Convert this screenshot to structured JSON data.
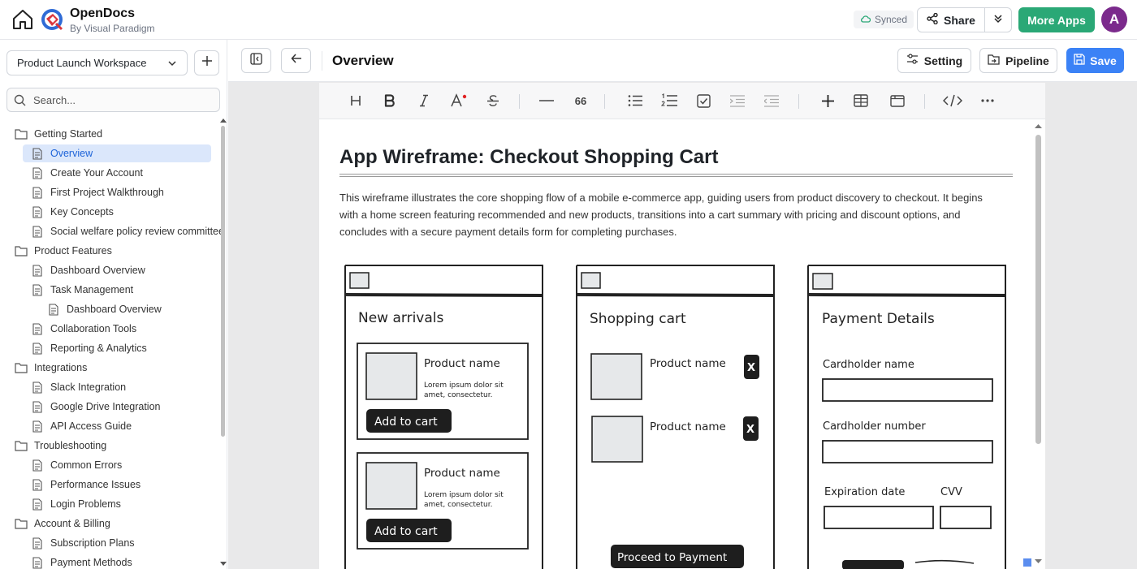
{
  "app": {
    "title": "OpenDocs",
    "subtitle": "By Visual Paradigm",
    "synced_label": "Synced",
    "share_label": "Share",
    "more_apps_label": "More Apps",
    "avatar_initial": "A",
    "accent_green": "#2aa876",
    "accent_blue": "#3b82f6",
    "avatar_color": "#7b2a8c"
  },
  "sidebar": {
    "workspace": "Product Launch Workspace",
    "search_placeholder": "Search...",
    "tree": [
      {
        "label": "Getting Started",
        "type": "folder",
        "level": 0
      },
      {
        "label": "Overview",
        "type": "doc",
        "level": 1,
        "active": true
      },
      {
        "label": "Create Your Account",
        "type": "doc",
        "level": 1
      },
      {
        "label": "First Project Walkthrough",
        "type": "doc",
        "level": 1
      },
      {
        "label": "Key Concepts",
        "type": "doc",
        "level": 1
      },
      {
        "label": "Social welfare policy review committee",
        "type": "doc",
        "level": 1
      },
      {
        "label": "Product Features",
        "type": "folder",
        "level": 0
      },
      {
        "label": "Dashboard Overview",
        "type": "doc",
        "level": 1
      },
      {
        "label": "Task Management",
        "type": "doc",
        "level": 1
      },
      {
        "label": "Dashboard Overview",
        "type": "doc",
        "level": 2
      },
      {
        "label": "Collaboration Tools",
        "type": "doc",
        "level": 1
      },
      {
        "label": "Reporting & Analytics",
        "type": "doc",
        "level": 1
      },
      {
        "label": "Integrations",
        "type": "folder",
        "level": 0
      },
      {
        "label": "Slack Integration",
        "type": "doc",
        "level": 1
      },
      {
        "label": "Google Drive Integration",
        "type": "doc",
        "level": 1
      },
      {
        "label": "API Access Guide",
        "type": "doc",
        "level": 1
      },
      {
        "label": "Troubleshooting",
        "type": "folder",
        "level": 0
      },
      {
        "label": "Common Errors",
        "type": "doc",
        "level": 1
      },
      {
        "label": "Performance Issues",
        "type": "doc",
        "level": 1
      },
      {
        "label": "Login Problems",
        "type": "doc",
        "level": 1
      },
      {
        "label": "Account & Billing",
        "type": "folder",
        "level": 0
      },
      {
        "label": "Subscription Plans",
        "type": "doc",
        "level": 1
      },
      {
        "label": "Payment Methods",
        "type": "doc",
        "level": 1
      }
    ]
  },
  "header": {
    "page_title": "Overview",
    "setting_label": "Setting",
    "pipeline_label": "Pipeline",
    "save_label": "Save"
  },
  "toolbar": {
    "quote_glyph": "66"
  },
  "document": {
    "title": "App Wireframe: Checkout Shopping Cart",
    "paragraph": "This wireframe illustrates the core shopping flow of a mobile e-commerce app, guiding users from product discovery to checkout. It begins with a home screen featuring recommended and new products, transitions into a cart summary with pricing and discount options, and concludes with a secure payment details form for completing purchases."
  },
  "wireframe": {
    "screen1": {
      "heading": "New arrivals",
      "product_name": "Product name",
      "desc_line1": "Lorem ipsum dolor sit",
      "desc_line2": "amet, consectetur.",
      "button": "Add to cart"
    },
    "screen2": {
      "heading": "Shopping cart",
      "product_name": "Product name",
      "remove_glyph": "X",
      "button": "Proceed to Payment"
    },
    "screen3": {
      "heading": "Payment Details",
      "cardholder_name": "Cardholder name",
      "cardholder_number": "Cardholder number",
      "expiration": "Expiration date",
      "cvv": "CVV"
    }
  }
}
